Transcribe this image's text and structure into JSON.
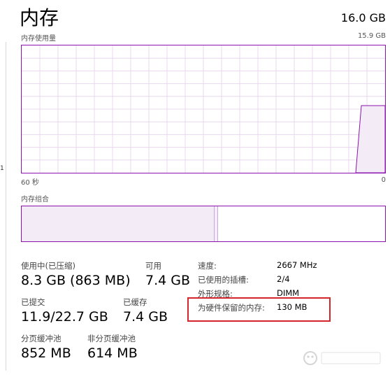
{
  "header": {
    "title": "内存",
    "total": "16.0 GB"
  },
  "usage_chart": {
    "label": "内存使用量",
    "max_label": "15.9 GB",
    "x_left_label": "60 秒",
    "x_right_label": "0",
    "accent_color": "#8b12ae",
    "fill_color": "#f3ecf6",
    "grid_color": "#e8d8ee"
  },
  "composition": {
    "label": "内存组合",
    "in_use_fraction": 0.53,
    "modified_fraction": 0.01
  },
  "stats": {
    "in_use_label": "使用中(已压缩)",
    "in_use_value": "8.3 GB (863 MB)",
    "available_label": "可用",
    "available_value": "7.4 GB",
    "committed_label": "已提交",
    "committed_value": "11.9/22.7 GB",
    "cached_label": "已缓存",
    "cached_value": "7.4 GB",
    "paged_label": "分页缓冲池",
    "paged_value": "852 MB",
    "nonpaged_label": "非分页缓冲池",
    "nonpaged_value": "614 MB"
  },
  "properties": {
    "speed_label": "速度:",
    "speed_value": "2667 MHz",
    "slots_label": "已使用的插槽:",
    "slots_value": "2/4",
    "form_label": "外形规格:",
    "form_value": "DIMM",
    "reserved_label": "为硬件保留的内存:",
    "reserved_value": "130 MB"
  },
  "highlight_color": "#d4252c"
}
